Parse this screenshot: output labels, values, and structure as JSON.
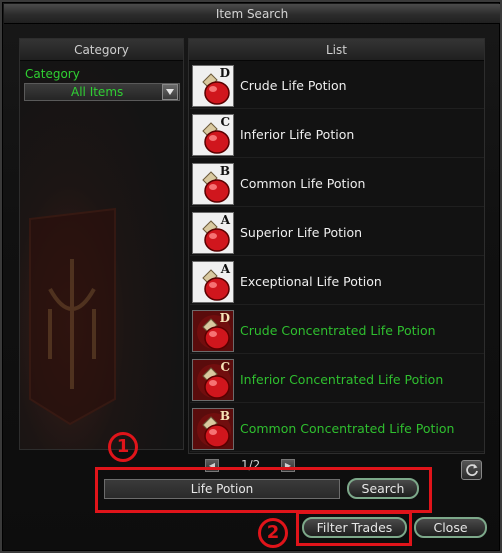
{
  "window": {
    "title": "Item Search"
  },
  "category": {
    "header": "Category",
    "label": "Category",
    "selected": "All Items"
  },
  "list": {
    "header": "List",
    "items": [
      {
        "name": "Crude Life Potion",
        "grade": "D",
        "color": "white"
      },
      {
        "name": "Inferior Life Potion",
        "grade": "C",
        "color": "white"
      },
      {
        "name": "Common Life Potion",
        "grade": "B",
        "color": "white"
      },
      {
        "name": "Superior Life Potion",
        "grade": "A",
        "color": "white"
      },
      {
        "name": "Exceptional Life Potion",
        "grade": "A",
        "color": "white"
      },
      {
        "name": "Crude Concentrated Life Potion",
        "grade": "D",
        "color": "green"
      },
      {
        "name": "Inferior Concentrated Life Potion",
        "grade": "C",
        "color": "green"
      },
      {
        "name": "Common Concentrated Life Potion",
        "grade": "B",
        "color": "green"
      }
    ]
  },
  "pager": {
    "page": "1/2"
  },
  "search": {
    "value": "Life Potion",
    "button": "Search"
  },
  "footer": {
    "filter_button": "Filter Trades",
    "close_button": "Close"
  },
  "annotations": {
    "one": "1",
    "two": "2"
  },
  "colors": {
    "annotation": "#e0141a",
    "green_text": "#2fbf2f",
    "category_green": "#2fd032"
  }
}
